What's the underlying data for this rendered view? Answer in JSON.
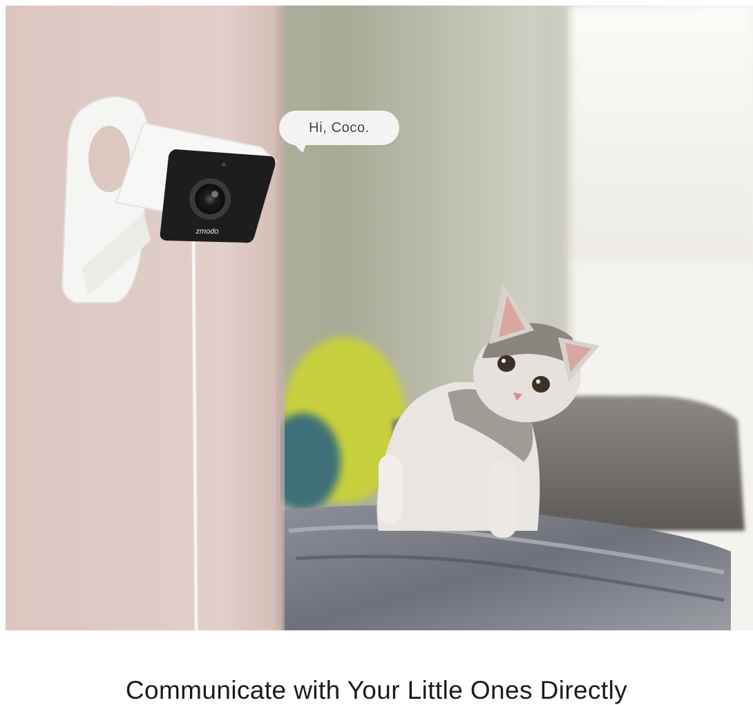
{
  "hero": {
    "image_alt_icon": "security-camera-with-kitten-photo-icon",
    "speech_bubble_text": "Hi, Coco.",
    "camera_brand_text": "zmodo"
  },
  "caption": {
    "text": "Communicate with Your Little Ones Directly"
  },
  "colors": {
    "wall": "#ddc8c2",
    "room": "#b9b8a9",
    "pillow": "#c9d23d",
    "camera_body": "#f7f7f5",
    "camera_face": "#1c1c1c",
    "text": "#1a1a1a"
  }
}
